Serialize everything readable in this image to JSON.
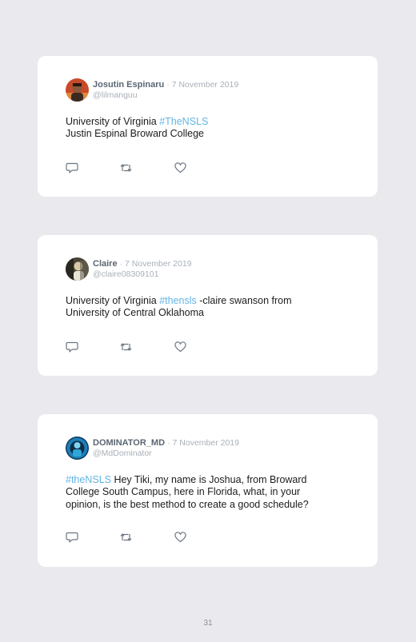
{
  "tweets": [
    {
      "name": "Josutin Espinaru",
      "separator": "·",
      "date": "7 November 2019",
      "handle": "@lilmanguu",
      "avatar_icon": "user-photo-icon",
      "text_before": "University of Virginia ",
      "hashtag": "#TheNSLS",
      "text_after": "\nJustin Espinal Broward College"
    },
    {
      "name": "Claire",
      "separator": "·",
      "date": "7 November 2019",
      "handle": "@claire08309101",
      "avatar_icon": "user-photo-icon",
      "text_before": "University of Virginia ",
      "hashtag": "#thensls",
      "text_after": " -claire swanson from University of Central Oklahoma"
    },
    {
      "name": "DOMINATOR_MD",
      "separator": "·",
      "date": "7 November 2019",
      "handle": "@MdDominator",
      "avatar_icon": "user-photo-icon",
      "text_before": "",
      "hashtag": "#theNSLS",
      "text_after": " Hey Tiki, my name is Joshua, from Broward College South Campus, here in Florida, what, in your opinion, is the best method to create a good schedule?"
    }
  ],
  "action_icons": [
    "reply-icon",
    "retweet-icon",
    "like-icon"
  ],
  "colors": {
    "background": "#e9e9ee",
    "card": "#ffffff",
    "name": "#5b6672",
    "meta": "#a9b0b8",
    "hashtag": "#62b4e3",
    "body_text": "#1c1c1c"
  },
  "footer": {
    "page_number": "31"
  }
}
